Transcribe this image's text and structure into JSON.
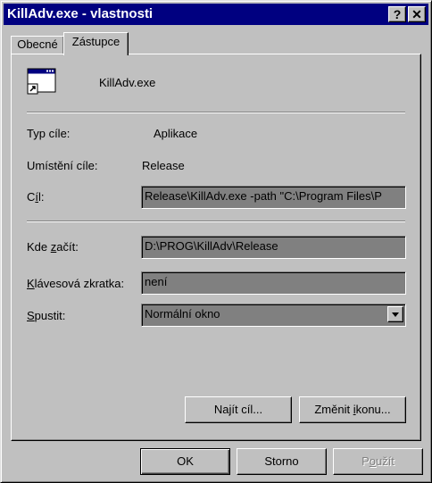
{
  "window": {
    "title": "KillAdv.exe - vlastnosti"
  },
  "titlebar": {
    "help_glyph": "?",
    "close_glyph": "✕"
  },
  "tabs": [
    {
      "label": "Obecné"
    },
    {
      "label": "Zástupce"
    }
  ],
  "shortcut": {
    "name": "KillAdv.exe",
    "target_type_label": "Typ cíle:",
    "target_type_value": "Aplikace",
    "target_location_label": "Umístění cíle:",
    "target_location_value": "Release",
    "target_label_pre": "C",
    "target_label_ul": "í",
    "target_label_post": "l:",
    "target_value": "Release\\KillAdv.exe -path \"C:\\Program Files\\P",
    "start_in_label_pre": "Kde ",
    "start_in_label_ul": "z",
    "start_in_label_post": "ačít:",
    "start_in_value": "D:\\PROG\\KillAdv\\Release",
    "hotkey_label_pre": "",
    "hotkey_label_ul": "K",
    "hotkey_label_post": "lávesová zkratka:",
    "hotkey_value": "není",
    "run_label_pre": "",
    "run_label_ul": "S",
    "run_label_post": "pustit:",
    "run_value": "Normální okno"
  },
  "buttons": {
    "find_target_pre": "Na",
    "find_target_ul": "j",
    "find_target_post": "ít cíl...",
    "change_icon_pre": "Změnit ",
    "change_icon_ul": "i",
    "change_icon_post": "konu...",
    "ok": "OK",
    "cancel": "Storno",
    "apply_pre": "P",
    "apply_ul": "o",
    "apply_post": "užít"
  },
  "colors": {
    "titlebar": "#000080",
    "face": "#c0c0c0",
    "field_bg": "#808080"
  }
}
